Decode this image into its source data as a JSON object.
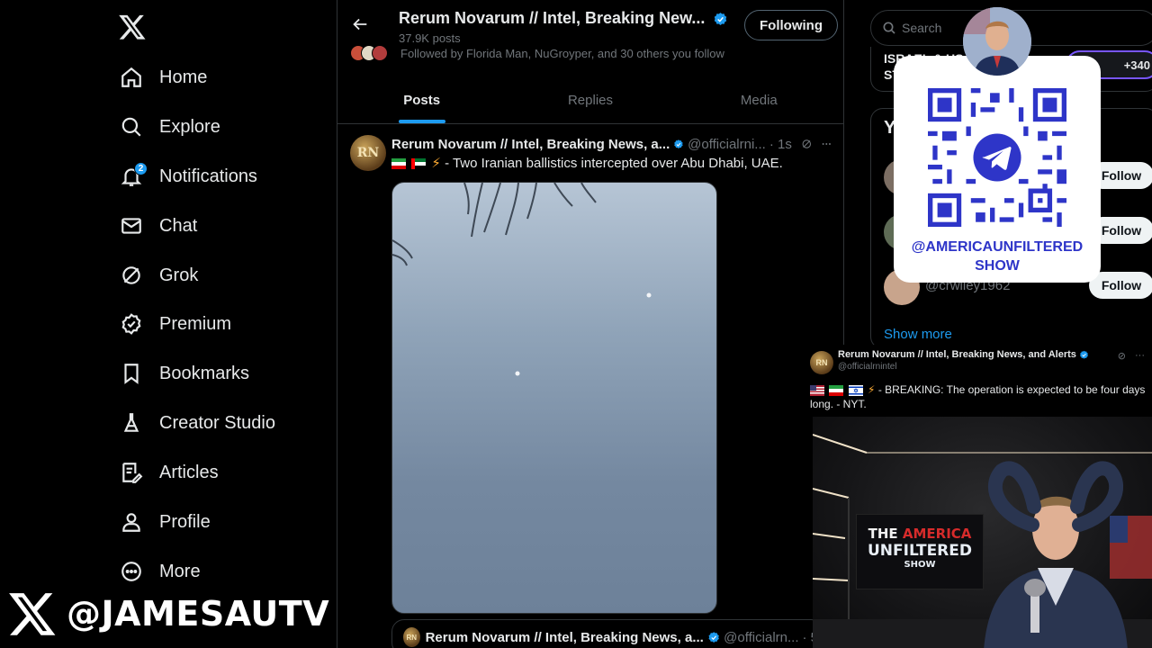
{
  "colors": {
    "accent": "#1d9bf0",
    "background": "#000000",
    "muted": "#71767b",
    "qr_blue": "#2e35c8"
  },
  "nav": {
    "items": [
      {
        "label": "Home",
        "icon": "home-icon"
      },
      {
        "label": "Explore",
        "icon": "search-icon"
      },
      {
        "label": "Notifications",
        "icon": "bell-icon",
        "badge": "2"
      },
      {
        "label": "Chat",
        "icon": "mail-icon"
      },
      {
        "label": "Grok",
        "icon": "grok-icon"
      },
      {
        "label": "Premium",
        "icon": "verified-badge-icon"
      },
      {
        "label": "Bookmarks",
        "icon": "bookmark-icon"
      },
      {
        "label": "Creator Studio",
        "icon": "flask-icon"
      },
      {
        "label": "Articles",
        "icon": "article-icon"
      },
      {
        "label": "Profile",
        "icon": "person-icon"
      },
      {
        "label": "More",
        "icon": "more-circle-icon"
      }
    ]
  },
  "overlay_handle": "@JAMESAUTV",
  "profile": {
    "title": "Rerum Novarum // Intel, Breaking New...",
    "posts_count": "37.9K posts",
    "followed_by": "Followed by Florida Man, NuGroyper, and 30 others you follow",
    "following_label": "Following"
  },
  "tabs": [
    "Posts",
    "Replies",
    "Media"
  ],
  "post": {
    "avatar_initials": "RN",
    "name": "Rerum Novarum // Intel, Breaking News, a...",
    "handle": "@officialrni...",
    "time": "· 1s",
    "text": "- Two Iranian ballistics intercepted over Abu Dhabi, UAE."
  },
  "quoted": {
    "name": "Rerum Novarum // Intel, Breaking News, a...",
    "handle": "@officialrn...",
    "time": "· 5r"
  },
  "right": {
    "search_placeholder": "Search",
    "card1_text": "ISRAEL & US STRIKE",
    "card1_line1": "ISRAEL & US",
    "card1_line2": "ST",
    "plus_count": "+340",
    "card2_title_initial": "Y",
    "follow_label": "Follow",
    "follow_handle": "@crwiley1962",
    "show_more": "Show more"
  },
  "qr": {
    "caption_line1": "@AMERICAUNFILTERED",
    "caption_line2": "SHOW"
  },
  "embed": {
    "avatar_initials": "RN",
    "name": "Rerum Novarum // Intel, Breaking News, and Alerts",
    "handle": "@officialrnintel",
    "text": "- BREAKING: The operation is expected to be four days long. - NYT."
  },
  "webcam": {
    "logo_the": "THE",
    "logo_america": "AMERICA",
    "logo_unfiltered": "UNFILTERED",
    "logo_show": "SHOW"
  }
}
